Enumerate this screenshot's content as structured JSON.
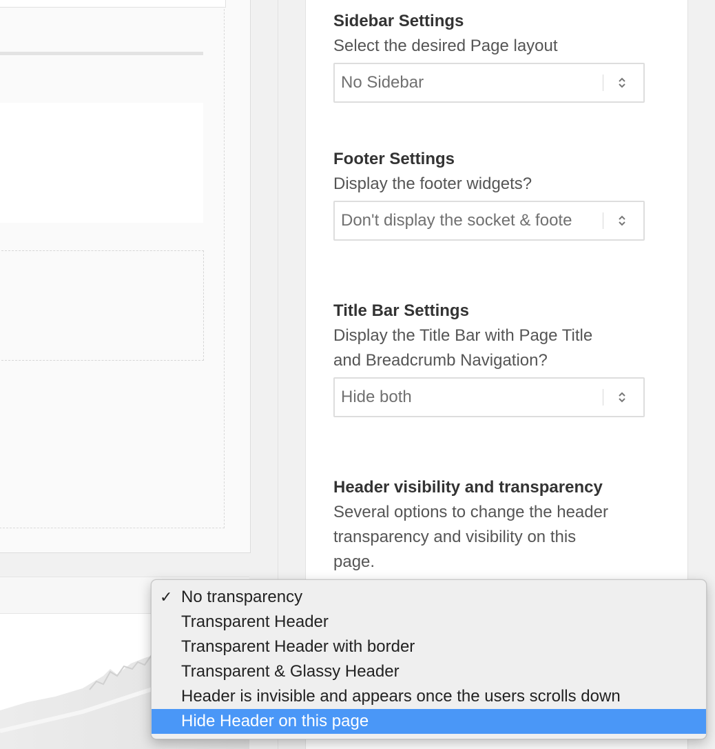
{
  "sections": [
    {
      "title": "Sidebar Settings",
      "description": "Select the desired Page layout",
      "select_value": "No Sidebar"
    },
    {
      "title": "Footer Settings",
      "description": "Display the footer widgets?",
      "select_value": "Don't display the socket & foote"
    },
    {
      "title": "Title Bar Settings",
      "description_line1": "Display the Title Bar with Page Title",
      "description_line2": "and Breadcrumb Navigation?",
      "select_value": "Hide both"
    },
    {
      "title": "Header visibility and transparency",
      "description_line1": "Several options to change the header",
      "description_line2": "transparency and visibility on this",
      "description_line3": "page."
    }
  ],
  "header_dropdown": {
    "checkmark": "✓",
    "options": [
      "No transparency",
      "Transparent Header",
      "Transparent Header with border",
      "Transparent & Glassy Header",
      "Header is invisible and appears once the users scrolls down",
      "Hide Header on this page"
    ],
    "selected_option": "No transparency",
    "highlighted_option": "Hide Header on this page",
    "highlight_color": "#4a97f7"
  },
  "icons": {
    "select_arrows": "up-down-chevron-icon",
    "checkmark": "checkmark-icon"
  }
}
